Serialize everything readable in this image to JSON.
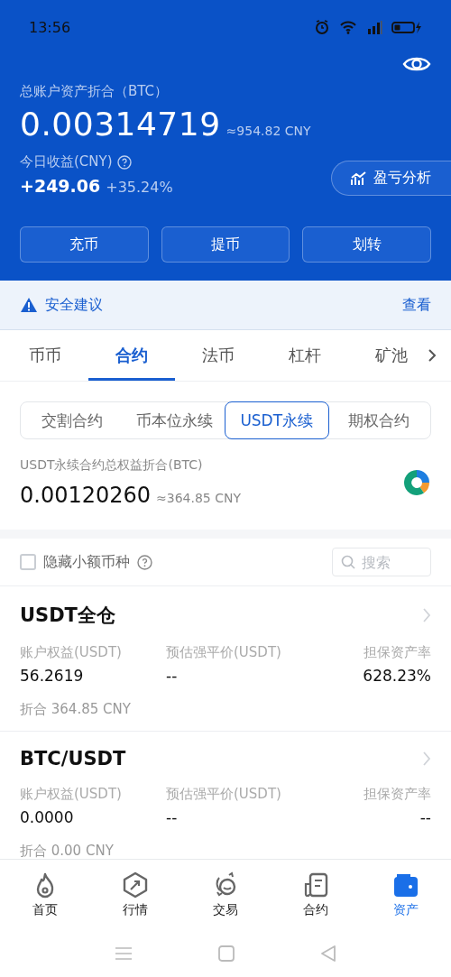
{
  "status_bar": {
    "time": "13:56"
  },
  "header": {
    "total_label": "总账户资产折合（BTC）",
    "total_btc": "0.00314719",
    "total_cny": "≈954.82 CNY",
    "today_label": "今日收益(CNY)",
    "today_pnl": "+249.06",
    "today_pct": "+35.24%",
    "analysis_button": "盈亏分析",
    "actions": [
      "充币",
      "提币",
      "划转"
    ]
  },
  "security": {
    "text": "安全建议",
    "link": "查看"
  },
  "tabs": [
    {
      "label": "币币",
      "selected": false
    },
    {
      "label": "合约",
      "selected": true
    },
    {
      "label": "法币",
      "selected": false
    },
    {
      "label": "杠杆",
      "selected": false
    },
    {
      "label": "矿池",
      "selected": false
    }
  ],
  "sub_tabs": [
    {
      "label": "交割合约",
      "selected": false
    },
    {
      "label": "币本位永续",
      "selected": false
    },
    {
      "label": "USDT永续",
      "selected": true
    },
    {
      "label": "期权合约",
      "selected": false
    }
  ],
  "summary": {
    "label": "USDT永续合约总权益折合(BTC)",
    "value": "0.00120260",
    "cny": "≈364.85 CNY"
  },
  "filter": {
    "checkbox_label": "隐藏小额币种",
    "checked": false,
    "search_placeholder": "搜索"
  },
  "accounts": [
    {
      "title": "USDT全仓",
      "columns": [
        {
          "label": "账户权益(USDT)",
          "value": "56.2619"
        },
        {
          "label": "预估强平价(USDT)",
          "value": "--"
        },
        {
          "label": "担保资产率",
          "value": "628.23%"
        }
      ],
      "converted": "折合 364.85 CNY"
    },
    {
      "title": "BTC/USDT",
      "columns": [
        {
          "label": "账户权益(USDT)",
          "value": "0.0000"
        },
        {
          "label": "预估强平价(USDT)",
          "value": "--"
        },
        {
          "label": "担保资产率",
          "value": "--"
        }
      ],
      "converted": "折合 0.00 CNY"
    }
  ],
  "bottom_nav": [
    {
      "label": "首页",
      "selected": false
    },
    {
      "label": "行情",
      "selected": false
    },
    {
      "label": "交易",
      "selected": false
    },
    {
      "label": "合约",
      "selected": false
    },
    {
      "label": "资产",
      "selected": true
    }
  ]
}
